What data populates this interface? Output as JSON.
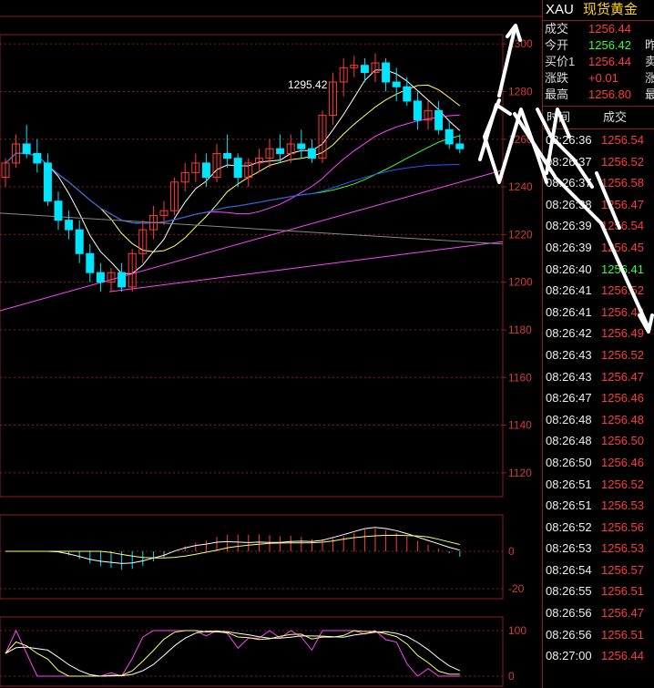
{
  "header": {
    "symbol": "XAU",
    "name": "现货黄金"
  },
  "quote": [
    {
      "label": "成交",
      "value": "1256.44",
      "color": "red",
      "extra": ""
    },
    {
      "label": "今开",
      "value": "1256.42",
      "color": "green",
      "extra": "昨"
    },
    {
      "label": "买价1",
      "value": "1256.44",
      "color": "red",
      "extra": "卖"
    },
    {
      "label": "涨跌",
      "value": "+0.01",
      "color": "red",
      "extra": "涨"
    },
    {
      "label": "最高",
      "value": "1256.80",
      "color": "red",
      "extra": "最"
    }
  ],
  "ticks_header": {
    "time": "时间",
    "price": "成交"
  },
  "ticks": [
    {
      "time": "08:26:36",
      "price": "1256.54",
      "color": "red"
    },
    {
      "time": "08:26:37",
      "price": "1256.52",
      "color": "red"
    },
    {
      "time": "08:26:37",
      "price": "1256.58",
      "color": "red"
    },
    {
      "time": "08:26:38",
      "price": "1256.47",
      "color": "red"
    },
    {
      "time": "08:26:39",
      "price": "1256.54",
      "color": "red"
    },
    {
      "time": "08:26:39",
      "price": "1256.45",
      "color": "red"
    },
    {
      "time": "08:26:40",
      "price": "1256.41",
      "color": "green"
    },
    {
      "time": "08:26:41",
      "price": "1256.52",
      "color": "red"
    },
    {
      "time": "08:26:41",
      "price": "1256.48",
      "color": "red"
    },
    {
      "time": "08:26:42",
      "price": "1256.49",
      "color": "red"
    },
    {
      "time": "08:26:43",
      "price": "1256.52",
      "color": "red"
    },
    {
      "time": "08:26:43",
      "price": "1256.47",
      "color": "red"
    },
    {
      "time": "08:26:47",
      "price": "1256.46",
      "color": "red"
    },
    {
      "time": "08:26:48",
      "price": "1256.48",
      "color": "red"
    },
    {
      "time": "08:26:48",
      "price": "1256.50",
      "color": "red"
    },
    {
      "time": "08:26:50",
      "price": "1256.46",
      "color": "red"
    },
    {
      "time": "08:26:51",
      "price": "1256.52",
      "color": "red"
    },
    {
      "time": "08:26:51",
      "price": "1256.53",
      "color": "red"
    },
    {
      "time": "08:26:52",
      "price": "1256.56",
      "color": "red"
    },
    {
      "time": "08:26:53",
      "price": "1256.53",
      "color": "red"
    },
    {
      "time": "08:26:54",
      "price": "1256.57",
      "color": "red"
    },
    {
      "time": "08:26:55",
      "price": "1256.51",
      "color": "red"
    },
    {
      "time": "08:26:56",
      "price": "1256.47",
      "color": "red"
    },
    {
      "time": "08:26:56",
      "price": "1256.51",
      "color": "red"
    },
    {
      "time": "08:27:00",
      "price": "1256.44",
      "color": "red"
    }
  ],
  "colors": {
    "up": "#ff3b3b",
    "down": "#00e5ff",
    "grid": "#8a1e1e",
    "ma5": "#ffffff",
    "ma10": "#ffff66",
    "ma20": "#ff44ff",
    "ma30": "#33ff33",
    "ma60": "#3355ff"
  },
  "chart_data": {
    "type": "candlestick",
    "y_ticks": [
      1300,
      1280,
      1260,
      1240,
      1220,
      1200,
      1180,
      1160,
      1140,
      1120
    ],
    "ylim": [
      1110,
      1310
    ],
    "annotation": "1295.42",
    "macd_ticks": [
      0,
      -20
    ],
    "kdj_ticks": [
      100,
      0
    ],
    "candles": [
      [
        1244,
        1252,
        1240,
        1250
      ],
      [
        1250,
        1262,
        1248,
        1258
      ],
      [
        1258,
        1266,
        1252,
        1254
      ],
      [
        1254,
        1260,
        1246,
        1250
      ],
      [
        1250,
        1254,
        1232,
        1234
      ],
      [
        1234,
        1238,
        1222,
        1226
      ],
      [
        1226,
        1230,
        1218,
        1222
      ],
      [
        1222,
        1226,
        1208,
        1212
      ],
      [
        1212,
        1216,
        1200,
        1204
      ],
      [
        1204,
        1208,
        1196,
        1200
      ],
      [
        1200,
        1206,
        1196,
        1204
      ],
      [
        1204,
        1208,
        1196,
        1198
      ],
      [
        1198,
        1214,
        1196,
        1212
      ],
      [
        1212,
        1226,
        1208,
        1222
      ],
      [
        1222,
        1232,
        1218,
        1228
      ],
      [
        1228,
        1234,
        1224,
        1230
      ],
      [
        1230,
        1244,
        1228,
        1242
      ],
      [
        1242,
        1250,
        1238,
        1246
      ],
      [
        1246,
        1254,
        1242,
        1250
      ],
      [
        1250,
        1254,
        1240,
        1244
      ],
      [
        1244,
        1258,
        1242,
        1254
      ],
      [
        1254,
        1262,
        1248,
        1252
      ],
      [
        1252,
        1254,
        1240,
        1244
      ],
      [
        1244,
        1252,
        1240,
        1250
      ],
      [
        1250,
        1256,
        1246,
        1252
      ],
      [
        1252,
        1260,
        1248,
        1256
      ],
      [
        1256,
        1262,
        1250,
        1254
      ],
      [
        1254,
        1262,
        1250,
        1258
      ],
      [
        1258,
        1264,
        1252,
        1256
      ],
      [
        1256,
        1260,
        1250,
        1252
      ],
      [
        1252,
        1272,
        1250,
        1270
      ],
      [
        1270,
        1288,
        1266,
        1284
      ],
      [
        1284,
        1294,
        1278,
        1290
      ],
      [
        1290,
        1295,
        1286,
        1291
      ],
      [
        1291,
        1294,
        1284,
        1288
      ],
      [
        1288,
        1296,
        1284,
        1292
      ],
      [
        1292,
        1294,
        1280,
        1284
      ],
      [
        1284,
        1290,
        1276,
        1282
      ],
      [
        1282,
        1286,
        1274,
        1276
      ],
      [
        1276,
        1280,
        1264,
        1268
      ],
      [
        1268,
        1276,
        1264,
        1272
      ],
      [
        1272,
        1276,
        1262,
        1264
      ],
      [
        1264,
        1268,
        1256,
        1258
      ],
      [
        1258,
        1262,
        1254,
        1256
      ]
    ]
  }
}
